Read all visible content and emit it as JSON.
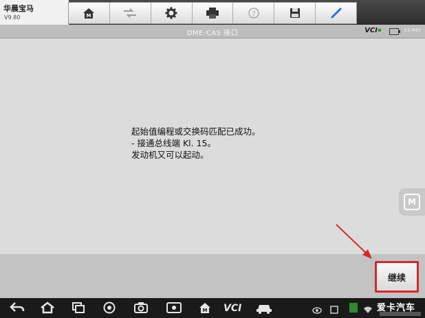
{
  "app": {
    "title": "华晨宝马",
    "version": "V9.80"
  },
  "toolbar": {
    "buttons": [
      {
        "icon": "home-m-icon"
      },
      {
        "icon": "vehicle-swap-icon"
      },
      {
        "icon": "gear-icon"
      },
      {
        "icon": "printer-icon"
      },
      {
        "icon": "help-icon"
      },
      {
        "icon": "save-icon"
      },
      {
        "icon": "pen-icon"
      }
    ]
  },
  "subbar": {
    "title": "DME-CAS 接口",
    "vci_label": "VCI",
    "voltage": "13.44V"
  },
  "message": {
    "lines": [
      "起始值编程或交换码匹配已成功。",
      "- 接通总线端 Kl. 15。",
      "发动机又可以起动。"
    ]
  },
  "side_button": {
    "label": "M"
  },
  "footer": {
    "continue_label": "继续"
  },
  "navbar": {
    "vci_label": "VCI"
  },
  "watermark": {
    "text": "爱卡汽车"
  },
  "colors": {
    "highlight": "#d7272a",
    "toolbar_blue": "#2a6fd1",
    "status_green": "#2f8a2f"
  }
}
